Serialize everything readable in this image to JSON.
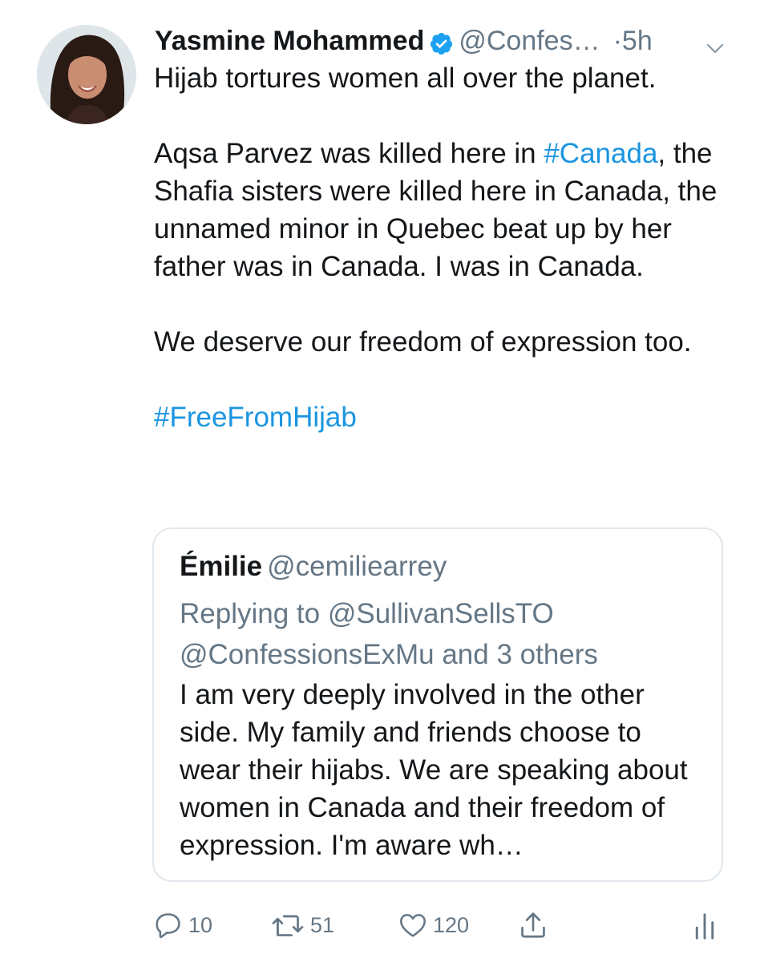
{
  "tweet": {
    "author_name": "Yasmine Mohammed",
    "author_handle": "@Confes…",
    "separator": "·",
    "time": "5h",
    "icons": {
      "verified": "verified-badge-icon",
      "menu": "chevron-down-icon"
    },
    "colors": {
      "link": "#1b95e0",
      "verified": "#1da1f2",
      "muted": "#657786",
      "text": "#14171a",
      "border": "#e1e8ed"
    },
    "text": {
      "line1": "Hijab tortures women all over the planet.",
      "p2_before": "Aqsa Parvez was killed here in ",
      "p2_hashtag": "#Canada",
      "p2_after": ", the Shafia sisters were killed here in Canada, the unnamed minor in Quebec beat up by her father was in Canada. I was in Canada.",
      "p3": "We deserve our freedom of expression too.",
      "hashtag": "#FreeFromHijab"
    }
  },
  "quoted_tweet": {
    "author_name": "Émilie",
    "author_handle": "@cemiliearrey",
    "replying_to_prefix": "Replying to ",
    "replying_to_user1": "@SullivanSellsTO",
    "replying_to_user2": "@ConfessionsExMu",
    "replying_to_suffix": " and 3 others",
    "body": "I am very deeply involved in the other side. My family and friends choose to wear their hijabs. We are speaking about women in Canada and their freedom of expression. I'm aware wh…"
  },
  "actions": {
    "reply": {
      "icon": "reply-icon",
      "count": "10"
    },
    "retweet": {
      "icon": "retweet-icon",
      "count": "51"
    },
    "like": {
      "icon": "heart-icon",
      "count": "120"
    },
    "share": {
      "icon": "share-icon"
    },
    "analytics": {
      "icon": "analytics-icon"
    }
  }
}
